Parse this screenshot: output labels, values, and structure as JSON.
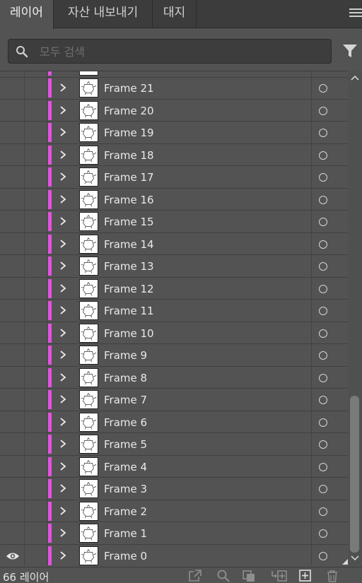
{
  "tabs": [
    {
      "label": "레이어",
      "active": true
    },
    {
      "label": "자산 내보내기",
      "active": false
    },
    {
      "label": "대지",
      "active": false
    }
  ],
  "panel_menu_icon": "hamburger-menu-icon",
  "search": {
    "placeholder": "모두 검색",
    "value": "",
    "icon": "search-icon"
  },
  "filter_icon": "filter-icon",
  "layers": [
    {
      "name": "Frame 21",
      "visible": false
    },
    {
      "name": "Frame 20",
      "visible": false
    },
    {
      "name": "Frame 19",
      "visible": false
    },
    {
      "name": "Frame 18",
      "visible": false
    },
    {
      "name": "Frame 17",
      "visible": false
    },
    {
      "name": "Frame 16",
      "visible": false
    },
    {
      "name": "Frame 15",
      "visible": false
    },
    {
      "name": "Frame 14",
      "visible": false
    },
    {
      "name": "Frame 13",
      "visible": false
    },
    {
      "name": "Frame 12",
      "visible": false
    },
    {
      "name": "Frame 11",
      "visible": false
    },
    {
      "name": "Frame 10",
      "visible": false
    },
    {
      "name": "Frame 9",
      "visible": false
    },
    {
      "name": "Frame 8",
      "visible": false
    },
    {
      "name": "Frame 7",
      "visible": false
    },
    {
      "name": "Frame 6",
      "visible": false
    },
    {
      "name": "Frame 5",
      "visible": false
    },
    {
      "name": "Frame 4",
      "visible": false
    },
    {
      "name": "Frame 3",
      "visible": false
    },
    {
      "name": "Frame 2",
      "visible": false
    },
    {
      "name": "Frame 1",
      "visible": false
    },
    {
      "name": "Frame 0",
      "visible": true
    }
  ],
  "layer_color": "#e252de",
  "scroll_position": 0.92,
  "footer": {
    "layer_count": "66 레이어",
    "buttons": [
      "export-icon",
      "locate-object-icon",
      "clipping-mask-icon",
      "new-sublayer-icon",
      "new-layer-icon",
      "delete-icon"
    ]
  }
}
